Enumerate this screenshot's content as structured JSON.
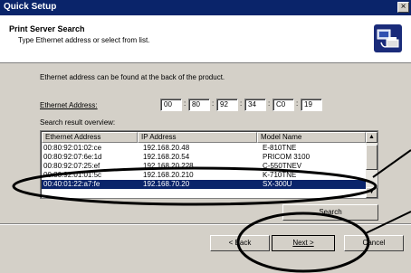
{
  "window": {
    "title": "Quick Setup",
    "close_glyph": "×"
  },
  "header": {
    "title": "Print Server Search",
    "subtitle": "Type Ethernet address or select from list.",
    "icon": "network-printer-icon"
  },
  "body": {
    "info": "Ethernet address can be found at the back of the product.",
    "ethernet_label": "Ethernet Address:",
    "ethernet_segments": [
      "00",
      "80",
      "92",
      "34",
      "C0",
      "19"
    ],
    "search_result_label": "Search result overview:"
  },
  "table": {
    "columns": [
      "Ethernet Address",
      "IP Address",
      "Model Name"
    ],
    "rows": [
      {
        "mac": "00:80:92:01:02:ce",
        "ip": "192.168.20.48",
        "model": "E-810TNE",
        "selected": false
      },
      {
        "mac": "00:80:92:07:6e:1d",
        "ip": "192.168.20.54",
        "model": "PRICOM 3100",
        "selected": false
      },
      {
        "mac": "00:80:92:07:25:ef",
        "ip": "192.168.20.228",
        "model": "C-550TNEV",
        "selected": false
      },
      {
        "mac": "00:80:92:01:01:5c",
        "ip": "192.168.20.210",
        "model": "K-710TNE",
        "selected": false
      },
      {
        "mac": "00:40:01:22:a7:fe",
        "ip": "192.168.70.20",
        "model": "SX-300U",
        "selected": true
      }
    ]
  },
  "buttons": {
    "search": "Search",
    "back": "< Back",
    "next": "Next >",
    "cancel": "Cancel"
  },
  "colors": {
    "title_bar": "#0a246a",
    "dialog_bg": "#d4d0c8",
    "selection": "#0a246a"
  }
}
